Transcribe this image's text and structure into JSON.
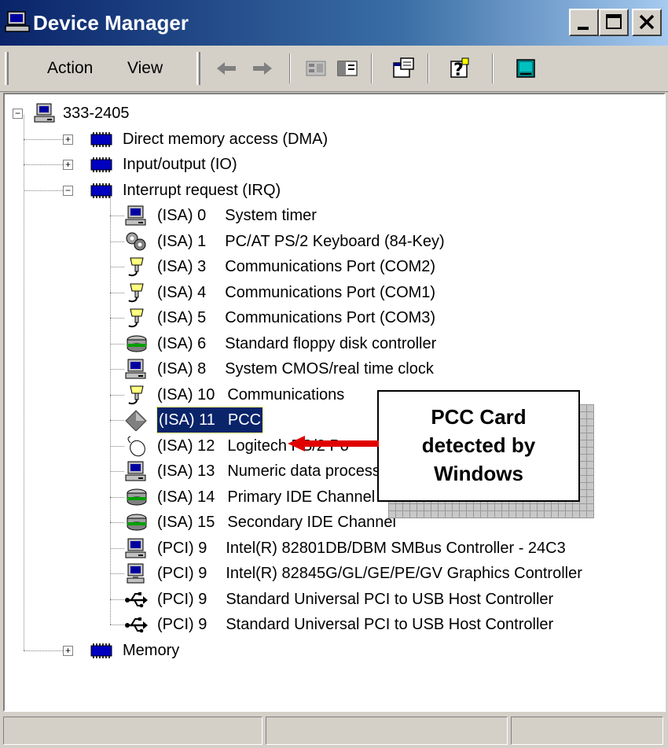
{
  "window": {
    "title": "Device Manager",
    "title_icon": "device-manager-icon"
  },
  "menu": {
    "action": "Action",
    "view": "View"
  },
  "toolbar": {
    "buttons": [
      "back-arrow-icon",
      "forward-arrow-icon",
      "folder-view-icon",
      "show-hide-tree-icon",
      "properties-icon",
      "help-icon",
      "scan-hardware-icon"
    ]
  },
  "tree": {
    "root": "333-2405",
    "groups": [
      {
        "label": "Direct memory access (DMA)",
        "expanded": false
      },
      {
        "label": "Input/output (IO)",
        "expanded": false
      },
      {
        "label": "Interrupt request (IRQ)",
        "expanded": true
      },
      {
        "label": "Memory",
        "expanded": false
      }
    ],
    "irq_items": [
      {
        "bus": "(ISA) 0",
        "name": "System timer",
        "icon": "computer-icon"
      },
      {
        "bus": "(ISA) 1",
        "name": "PC/AT PS/2 Keyboard (84-Key)",
        "icon": "keyboard-icon"
      },
      {
        "bus": "(ISA) 3",
        "name": "Communications Port (COM2)",
        "icon": "port-icon"
      },
      {
        "bus": "(ISA) 4",
        "name": "Communications Port (COM1)",
        "icon": "port-icon"
      },
      {
        "bus": "(ISA) 5",
        "name": "Communications Port (COM3)",
        "icon": "port-icon"
      },
      {
        "bus": "(ISA) 6",
        "name": "Standard floppy disk controller",
        "icon": "disk-controller-icon"
      },
      {
        "bus": "(ISA) 8",
        "name": "System CMOS/real time clock",
        "icon": "computer-icon"
      },
      {
        "bus": "(ISA) 10",
        "name": "Communications",
        "icon": "port-icon"
      },
      {
        "bus": "(ISA) 11",
        "name": "PCC",
        "icon": "unknown-device-icon",
        "selected": true
      },
      {
        "bus": "(ISA) 12",
        "name": "Logitech PS/2 Po",
        "icon": "mouse-icon"
      },
      {
        "bus": "(ISA) 13",
        "name": "Numeric data processor",
        "icon": "computer-icon"
      },
      {
        "bus": "(ISA) 14",
        "name": "Primary IDE Channel",
        "icon": "disk-controller-icon"
      },
      {
        "bus": "(ISA) 15",
        "name": "Secondary IDE Channel",
        "icon": "disk-controller-icon"
      },
      {
        "bus": "(PCI) 9",
        "name": "Intel(R) 82801DB/DBM SMBus Controller - 24C3",
        "icon": "computer-icon"
      },
      {
        "bus": "(PCI) 9",
        "name": "Intel(R) 82845G/GL/GE/PE/GV Graphics Controller",
        "icon": "display-icon"
      },
      {
        "bus": "(PCI) 9",
        "name": "Standard Universal PCI to USB Host Controller",
        "icon": "usb-icon"
      },
      {
        "bus": "(PCI) 9",
        "name": "Standard Universal PCI to USB Host Controller",
        "icon": "usb-icon"
      }
    ]
  },
  "callout": {
    "lines": [
      "PCC Card",
      "detected by",
      "Windows"
    ]
  },
  "colors": {
    "titlebar_start": "#0a246a",
    "titlebar_end": "#a6caf0",
    "selection": "#0a246a",
    "arrow": "#e00000",
    "chip_blue": "#0000c0"
  }
}
